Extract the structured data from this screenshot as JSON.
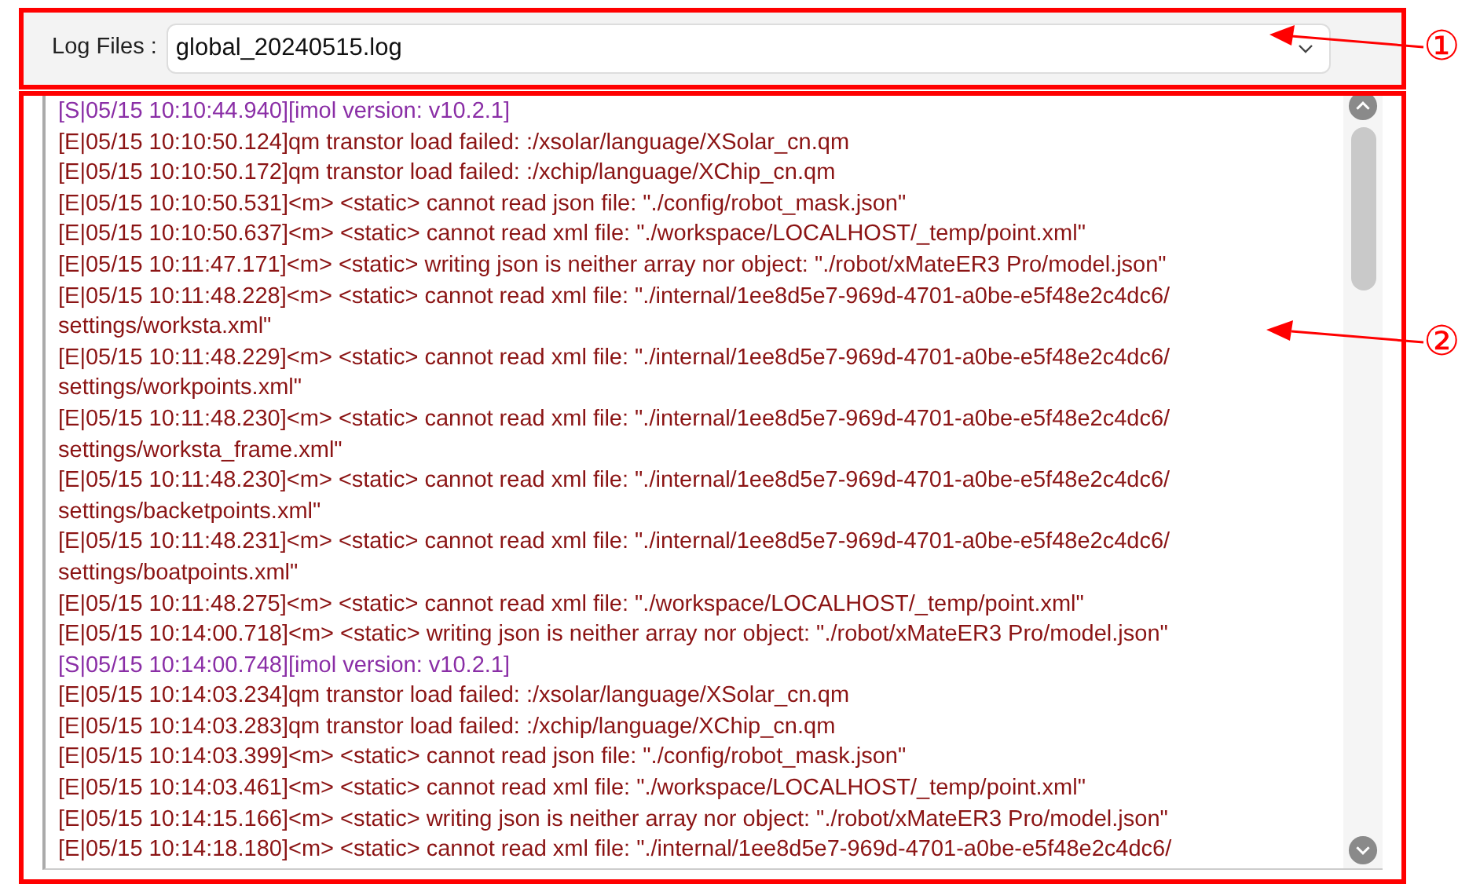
{
  "file_selector": {
    "label": "Log Files :",
    "value": "global_20240515.log"
  },
  "log_entries": [
    {
      "kind": "status",
      "text": "[S|05/15 10:10:44.940][imol version: v10.2.1]"
    },
    {
      "kind": "error",
      "text": "[E|05/15 10:10:50.124]qm transtor load failed: :/xsolar/language/XSolar_cn.qm"
    },
    {
      "kind": "error",
      "text": "[E|05/15 10:10:50.172]qm transtor load failed: :/xchip/language/XChip_cn.qm"
    },
    {
      "kind": "error",
      "text": "[E|05/15 10:10:50.531]<m> <static> cannot read json file: \"./config/robot_mask.json\""
    },
    {
      "kind": "error",
      "text": "[E|05/15 10:10:50.637]<m> <static> cannot read xml file: \"./workspace/LOCALHOST/_temp/point.xml\""
    },
    {
      "kind": "error",
      "text": "[E|05/15 10:11:47.171]<m> <static> writing json is neither array nor object: \"./robot/xMateER3 Pro/model.json\""
    },
    {
      "kind": "error",
      "text": "[E|05/15 10:11:48.228]<m> <static> cannot read xml file: \"./internal/1ee8d5e7-969d-4701-a0be-e5f48e2c4dc6/\nsettings/worksta.xml\""
    },
    {
      "kind": "error",
      "text": "[E|05/15 10:11:48.229]<m> <static> cannot read xml file: \"./internal/1ee8d5e7-969d-4701-a0be-e5f48e2c4dc6/\nsettings/workpoints.xml\""
    },
    {
      "kind": "error",
      "text": "[E|05/15 10:11:48.230]<m> <static> cannot read xml file: \"./internal/1ee8d5e7-969d-4701-a0be-e5f48e2c4dc6/\nsettings/worksta_frame.xml\""
    },
    {
      "kind": "error",
      "text": "[E|05/15 10:11:48.230]<m> <static> cannot read xml file: \"./internal/1ee8d5e7-969d-4701-a0be-e5f48e2c4dc6/\nsettings/backetpoints.xml\""
    },
    {
      "kind": "error",
      "text": "[E|05/15 10:11:48.231]<m> <static> cannot read xml file: \"./internal/1ee8d5e7-969d-4701-a0be-e5f48e2c4dc6/\nsettings/boatpoints.xml\""
    },
    {
      "kind": "error",
      "text": "[E|05/15 10:11:48.275]<m> <static> cannot read xml file: \"./workspace/LOCALHOST/_temp/point.xml\""
    },
    {
      "kind": "error",
      "text": "[E|05/15 10:14:00.718]<m> <static> writing json is neither array nor object: \"./robot/xMateER3 Pro/model.json\""
    },
    {
      "kind": "status",
      "text": "[S|05/15 10:14:00.748][imol version: v10.2.1]"
    },
    {
      "kind": "error",
      "text": "[E|05/15 10:14:03.234]qm transtor load failed: :/xsolar/language/XSolar_cn.qm"
    },
    {
      "kind": "error",
      "text": "[E|05/15 10:14:03.283]qm transtor load failed: :/xchip/language/XChip_cn.qm"
    },
    {
      "kind": "error",
      "text": "[E|05/15 10:14:03.399]<m> <static> cannot read json file: \"./config/robot_mask.json\""
    },
    {
      "kind": "error",
      "text": "[E|05/15 10:14:03.461]<m> <static> cannot read xml file: \"./workspace/LOCALHOST/_temp/point.xml\""
    },
    {
      "kind": "error",
      "text": "[E|05/15 10:14:15.166]<m> <static> writing json is neither array nor object: \"./robot/xMateER3 Pro/model.json\""
    },
    {
      "kind": "error",
      "text": "[E|05/15 10:14:18.180]<m> <static> cannot read xml file: \"./internal/1ee8d5e7-969d-4701-a0be-e5f48e2c4dc6/"
    }
  ],
  "annotations": [
    {
      "label": "①"
    },
    {
      "label": "②"
    }
  ]
}
